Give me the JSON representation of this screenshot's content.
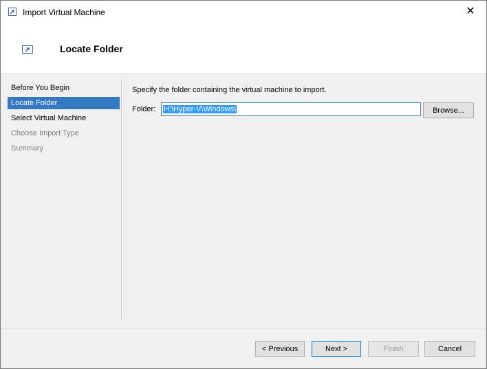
{
  "window": {
    "title": "Import Virtual Machine"
  },
  "header": {
    "title": "Locate Folder"
  },
  "nav": {
    "items": [
      {
        "label": "Before You Begin",
        "state": "normal"
      },
      {
        "label": "Locate Folder",
        "state": "active"
      },
      {
        "label": "Select Virtual Machine",
        "state": "normal"
      },
      {
        "label": "Choose Import Type",
        "state": "disabled"
      },
      {
        "label": "Summary",
        "state": "disabled"
      }
    ]
  },
  "main": {
    "instruction": "Specify the folder containing the virtual machine to import.",
    "folder_label": "Folder:",
    "folder_value": "H:\\Hyper-V\\Windows\\",
    "browse_label": "Browse..."
  },
  "footer": {
    "previous_label": "< Previous",
    "next_label": "Next >",
    "finish_label": "Finish",
    "cancel_label": "Cancel"
  },
  "colors": {
    "accent": "#3579c5",
    "selection": "#3399ff",
    "default_button_border": "#0078d7"
  }
}
